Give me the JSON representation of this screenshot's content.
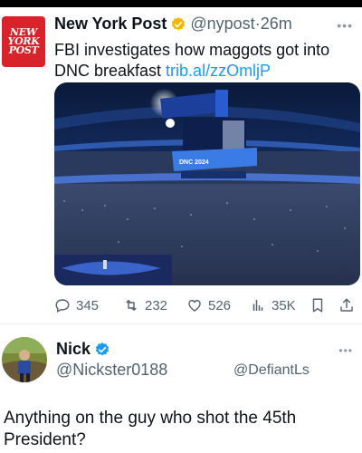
{
  "tweet": {
    "author_name": "New York Post",
    "author_handle": "@nypost",
    "time_ago": "26m",
    "avatar_text": [
      "NEW",
      "YORK",
      "POST"
    ],
    "text": "FBI investigates how maggots got into DNC breakfast ",
    "link": "trib.al/zzOmljP",
    "media_banner": "DNC 2024",
    "verified_color": "#f4b400",
    "stats": {
      "replies": "345",
      "retweets": "232",
      "likes": "526",
      "views": "35K"
    }
  },
  "reply": {
    "author_name": "Nick",
    "author_handle": "@Nickster0188",
    "mention": "@DefiantLs",
    "text": "Anything on the guy who shot the 45th President?",
    "verified_color": "#1d9bf0"
  },
  "colors": {
    "link": "#1d9bf0",
    "muted": "#536471",
    "brand_red": "#d8232a"
  },
  "icons": [
    "more-icon",
    "gold-verified-badge-icon",
    "reply-icon",
    "retweet-icon",
    "like-icon",
    "views-icon",
    "bookmark-icon",
    "share-icon",
    "blue-verified-badge-icon"
  ]
}
